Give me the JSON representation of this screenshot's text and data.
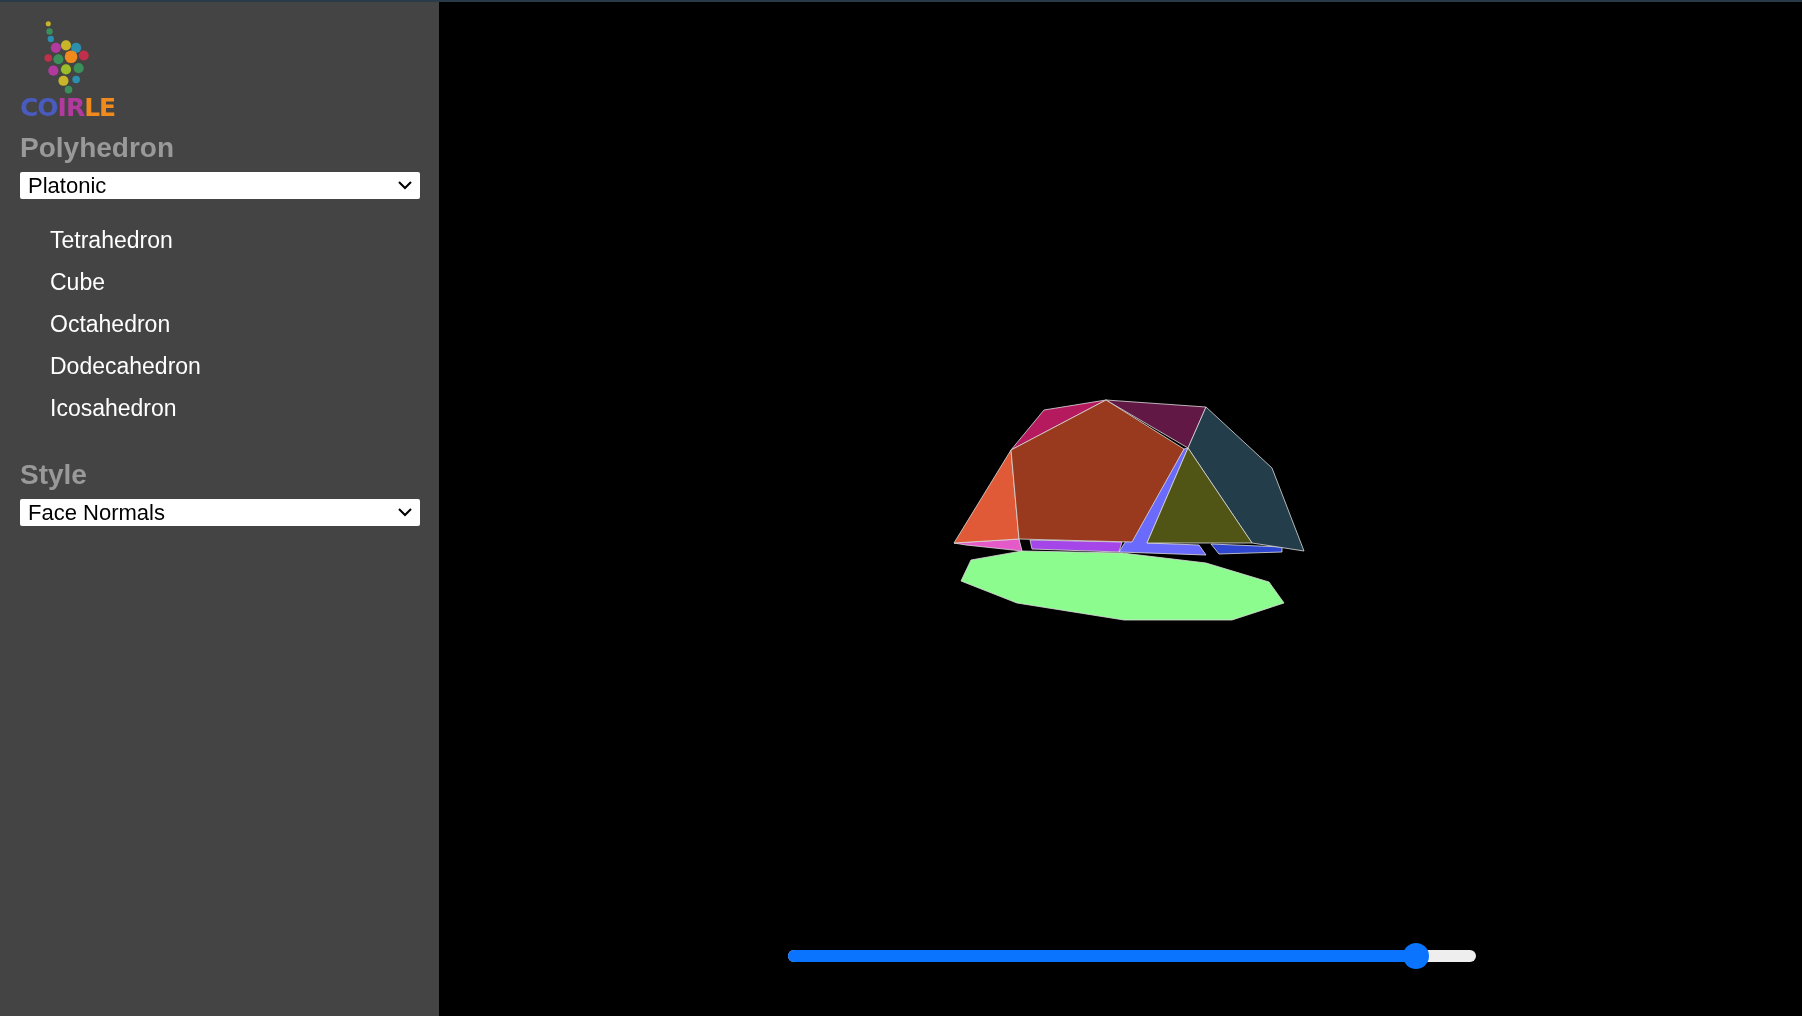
{
  "logo": {
    "parts": [
      {
        "text": "CO",
        "color": "#4a5bc0"
      },
      {
        "text": "IR",
        "color": "#b2399e"
      },
      {
        "text": "LE",
        "color": "#f08a1c"
      }
    ]
  },
  "sidebar": {
    "sections": [
      {
        "heading": "Polyhedron",
        "dropdown": {
          "value": "Platonic"
        },
        "items": [
          {
            "label": "Tetrahedron"
          },
          {
            "label": "Cube"
          },
          {
            "label": "Octahedron"
          },
          {
            "label": "Dodecahedron"
          },
          {
            "label": "Icosahedron"
          }
        ]
      },
      {
        "heading": "Style",
        "dropdown": {
          "value": "Face Normals"
        }
      }
    ]
  },
  "viewer": {
    "slider": {
      "level": 0.913
    }
  }
}
